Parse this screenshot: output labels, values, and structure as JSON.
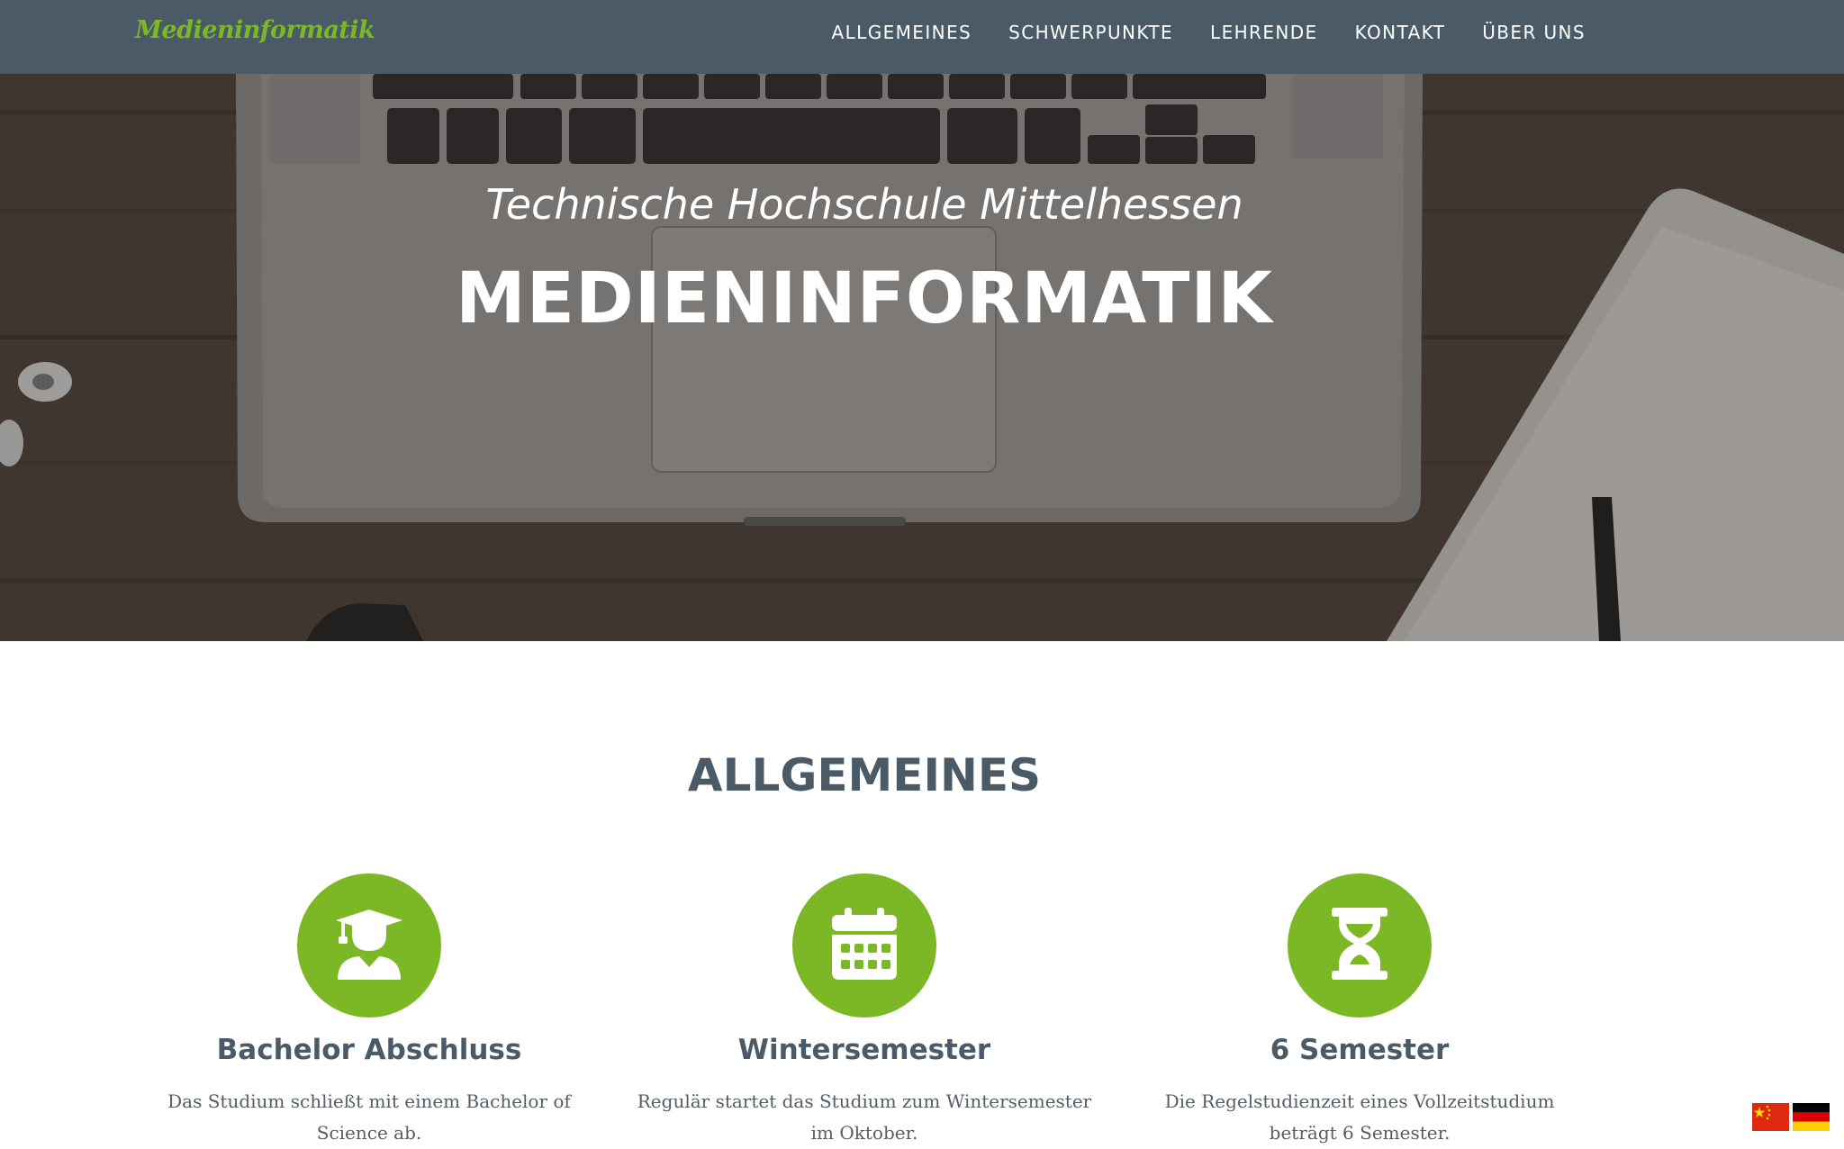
{
  "navbar": {
    "brand": "Medieninformatik",
    "links": [
      "ALLGEMEINES",
      "SCHWERPUNKTE",
      "LEHRENDE",
      "KONTAKT",
      "ÜBER UNS"
    ]
  },
  "hero": {
    "subtitle": "Technische Hochschule Mittelhessen",
    "title": "MEDIENINFORMATIK"
  },
  "section": {
    "heading": "ALLGEMEINES",
    "features": [
      {
        "icon": "graduate-icon",
        "title": "Bachelor Abschluss",
        "text": "Das Studium schließt mit einem Bachelor of Science ab."
      },
      {
        "icon": "calendar-icon",
        "title": "Wintersemester",
        "text": "Regulär startet das Studium zum Wintersemester im Oktober."
      },
      {
        "icon": "hourglass-icon",
        "title": "6 Semester",
        "text": "Die Regelstudienzeit eines Vollzeitstudium beträgt 6 Semester."
      }
    ]
  },
  "language_flags": [
    "china-flag-icon",
    "germany-flag-icon"
  ],
  "colors": {
    "navbar": "#4a5b67",
    "accent_green": "#7cb826",
    "heading": "#4a5b67"
  }
}
